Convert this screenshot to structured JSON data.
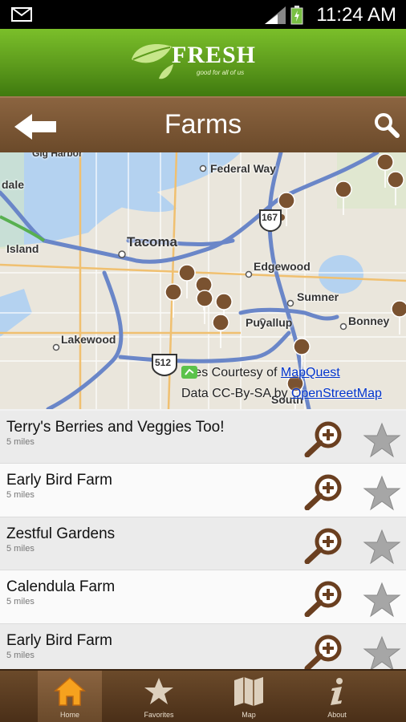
{
  "status_bar": {
    "time": "11:24 AM"
  },
  "brand": {
    "name": "FRESH",
    "tagline": "good for all of us"
  },
  "title_bar": {
    "title": "Farms"
  },
  "map": {
    "labels": {
      "gig_harbor": "Gig Harbor",
      "dale": "dale",
      "island": "Island",
      "federal_way": "Federal Way",
      "tacoma": "Tacoma",
      "edgewood": "Edgewood",
      "sumner": "Sumner",
      "lakewood": "Lakewood",
      "puyallup": "Puyallup",
      "bonney": "Bonney",
      "south": "South",
      "hwy_167": "167",
      "hwy_512": "512"
    },
    "attribution": {
      "tiles_prefix": "Tiles Courtesy of",
      "tiles_link": "MapQuest",
      "data_prefix": "Data CC-By-SA by",
      "data_link": "OpenStreetMap"
    },
    "pins_count": 13
  },
  "farms": [
    {
      "name": "Terry's Berries and Veggies Too!",
      "distance": "5 miles"
    },
    {
      "name": "Early Bird Farm",
      "distance": "5 miles"
    },
    {
      "name": "Zestful Gardens",
      "distance": "5 miles"
    },
    {
      "name": "Calendula Farm",
      "distance": "5 miles"
    },
    {
      "name": "Early Bird Farm",
      "distance": "5 miles"
    }
  ],
  "bottom_nav": {
    "tabs": [
      {
        "label": "Home",
        "icon": "home-icon"
      },
      {
        "label": "Favorites",
        "icon": "star-icon"
      },
      {
        "label": "Map",
        "icon": "map-icon"
      },
      {
        "label": "About",
        "icon": "info-icon"
      }
    ]
  },
  "colors": {
    "brand_green": "#5c9a1c",
    "brown_bar": "#6b4a2a",
    "pin_brown": "#7a5230",
    "highway_blue": "#6a86c8",
    "water_blue": "#b4d2f0",
    "link_blue": "#0033cc"
  }
}
